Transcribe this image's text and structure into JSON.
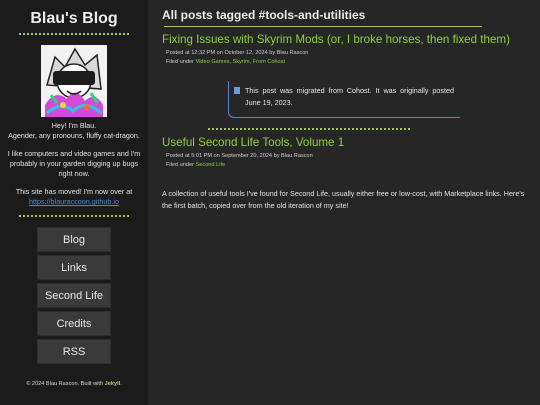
{
  "sidebar": {
    "site_title": "Blau's Blog",
    "bio": {
      "line1": "Hey! I'm Blau.",
      "line2": "Agender, any pronouns, fluffy cat-dragon.",
      "line3": "I like computers and video games and I'm probably in your garden digging up bugs right now.",
      "line4": "This site has moved! I'm now over at",
      "moved_link": "https://blauraccoon.github.io"
    },
    "nav": [
      "Blog",
      "Links",
      "Second Life",
      "Credits",
      "RSS"
    ],
    "footer": {
      "text": "© 2024 Blau Rascon. Built with",
      "jekyll": "Jekyll",
      "period": "."
    }
  },
  "main": {
    "page_title": "All posts tagged #tools-and-utilities",
    "posts": [
      {
        "title": "Fixing Issues with Skyrim Mods (or, I broke horses, then fixed them)",
        "posted": "Posted at 12:32 PM on October 12, 2024 by Blau Rascon",
        "filed_prefix": "Filed under",
        "tags": [
          "Video Games",
          "Skyrim",
          "From Cohost"
        ],
        "note": "This post was migrated from Cohost. It was originally posted June 19, 2023."
      },
      {
        "title": "Useful Second Life Tools, Volume 1",
        "posted": "Posted at 5:01 PM on September 20, 2024 by Blau Rascon",
        "filed_prefix": "Filed under",
        "tags": [
          "Second Life"
        ],
        "excerpt": "A collection of useful tools I've found for Second Life, usually either free or low-cost, with Marketplace links. Here's the first batch, copied over from the old iteration of my site!"
      }
    ]
  },
  "colors": {
    "accent_green": "#8fd13f",
    "link_blue": "#4b8cd6",
    "sidebar_bg": "#1b1b1b",
    "main_bg": "#262626"
  }
}
